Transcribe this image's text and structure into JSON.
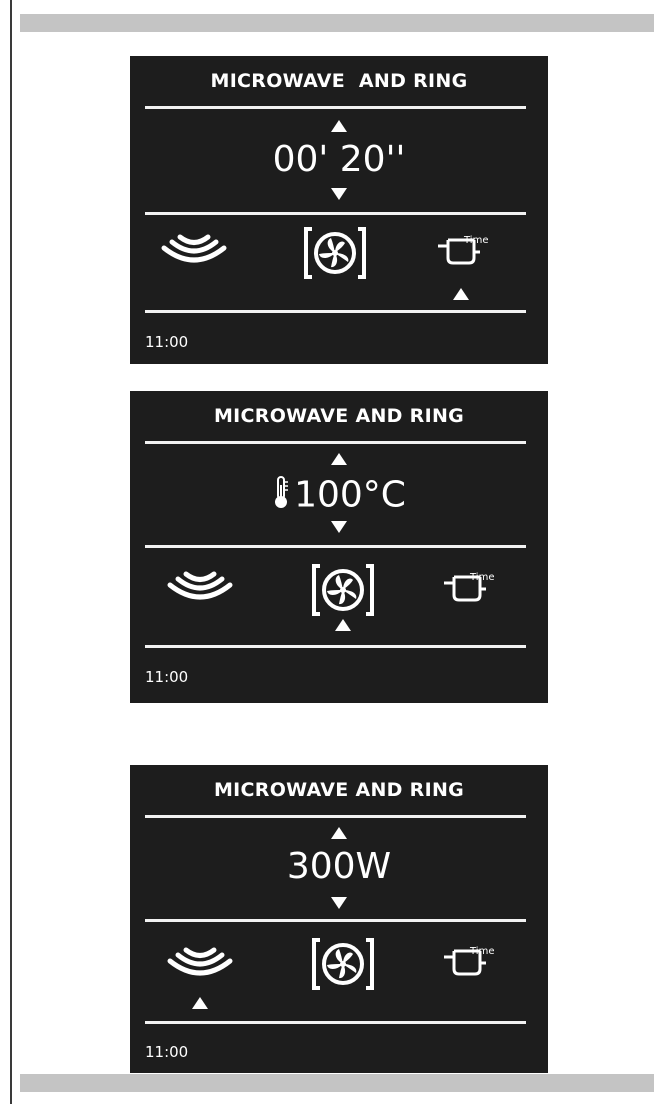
{
  "screens": [
    {
      "title": "MICROWAVE  AND RING",
      "value": "00' 20''",
      "time": "11:00",
      "selected": "time-icon"
    },
    {
      "title": "MICROWAVE AND RING",
      "value": "100°C",
      "time": "11:00",
      "selected": "fan-icon"
    },
    {
      "title": "MICROWAVE AND RING",
      "value": "300W",
      "time": "11:00",
      "selected": "microwave-icon"
    }
  ],
  "icons": {
    "microwave": "microwave-waves-icon",
    "fan": "ring-fan-icon",
    "time": "pot-time-icon",
    "time_label": "Time"
  },
  "colors": {
    "panel_bg": "#1d1d1d",
    "foreground": "#ffffff",
    "bar": "#c4c4c4"
  }
}
